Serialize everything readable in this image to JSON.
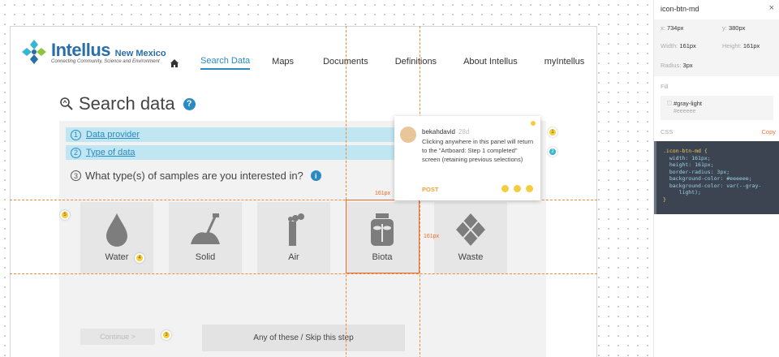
{
  "header": {
    "logo_name": "Intellus",
    "logo_region": "New Mexico",
    "logo_tagline": "Connecting Community, Science and Environment",
    "nav": [
      "Search Data",
      "Maps",
      "Documents",
      "Definitions",
      "About Intellus",
      "myIntellus"
    ],
    "nav_active": "Search Data"
  },
  "search": {
    "title": "Search data",
    "help_glyph": "?",
    "steps": [
      {
        "num": "1",
        "label": "Data provider"
      },
      {
        "num": "2",
        "label": "Type of data"
      }
    ],
    "question": {
      "num": "3",
      "text": "What type(s) of samples are you interested in?",
      "info_glyph": "i"
    },
    "tiles": [
      {
        "label": "Water",
        "icon": "water-drop-icon"
      },
      {
        "label": "Solid",
        "icon": "shovel-soil-icon"
      },
      {
        "label": "Air",
        "icon": "air-vent-icon"
      },
      {
        "label": "Biota",
        "icon": "dragonfly-jar-icon"
      },
      {
        "label": "Waste",
        "icon": "waste-diamond-icon"
      }
    ],
    "skip_label": "Any of these / Skip this step",
    "continue_label": "Continue >"
  },
  "measure": {
    "width_label": "161px",
    "height_label": "161px",
    "guide_color": "#ee8a3c"
  },
  "pins": [
    "1",
    "2",
    "3",
    "4",
    "5"
  ],
  "comment": {
    "author": "bekahdavid",
    "age": "28d",
    "body": "Clicking anywhere in this panel will return to the \"Artboard: Step 1 completed\" screen (retaining previous selections)",
    "post_label": "POST",
    "reactions": [
      "thumbs-up-icon",
      "thinking-face-icon",
      "sad-face-icon"
    ]
  },
  "inspector": {
    "title": "icon-btn-md",
    "close_glyph": "×",
    "x": {
      "label": "x:",
      "value": "734px"
    },
    "y": {
      "label": "y:",
      "value": "380px"
    },
    "width": {
      "label": "Width:",
      "value": "161px"
    },
    "height": {
      "label": "Height:",
      "value": "161px"
    },
    "radius": {
      "label": "Radius:",
      "value": "3px"
    },
    "fill_heading": "Fill",
    "fill_name": "#gray-light",
    "fill_hex": "#eeeeee",
    "css_heading": "CSS",
    "copy_label": "Copy",
    "css_lines": [
      ".icon-btn-md {",
      "  width: 161px;",
      "  height: 161px;",
      "  border-radius: 3px;",
      "  background-color: #eeeeee;",
      "  background-color: var(--gray-",
      "     light);",
      "}"
    ]
  },
  "colors": {
    "accent": "#2a8ac2",
    "step_bg": "#bfe6f1",
    "tile_bg": "#e6e6e6",
    "css_bg": "#3c4452"
  }
}
